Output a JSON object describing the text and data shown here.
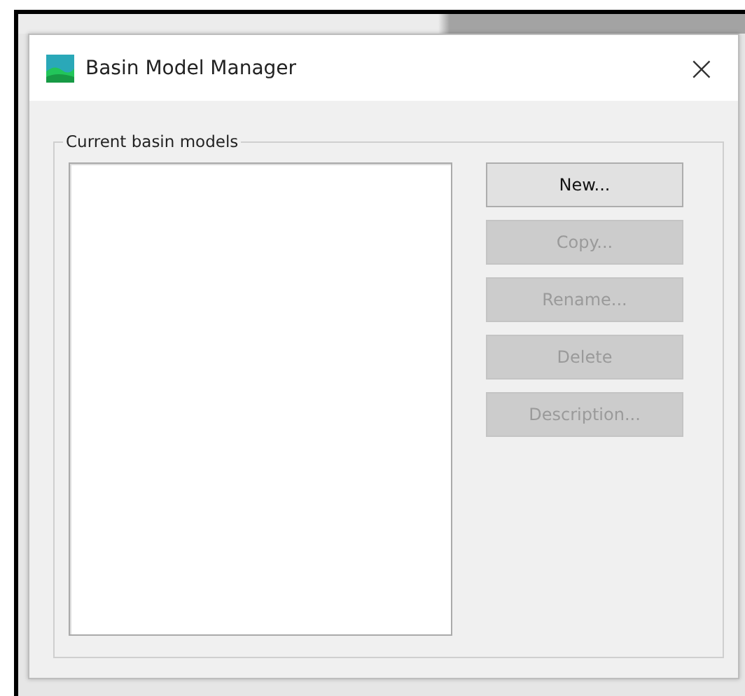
{
  "window": {
    "title": "Basin Model Manager",
    "close": "×"
  },
  "group": {
    "label": "Current basin models"
  },
  "buttons": [
    {
      "label": "New...",
      "disabled": false
    },
    {
      "label": "Copy...",
      "disabled": true
    },
    {
      "label": "Rename...",
      "disabled": true
    },
    {
      "label": "Delete",
      "disabled": true
    },
    {
      "label": "Description...",
      "disabled": true
    }
  ]
}
